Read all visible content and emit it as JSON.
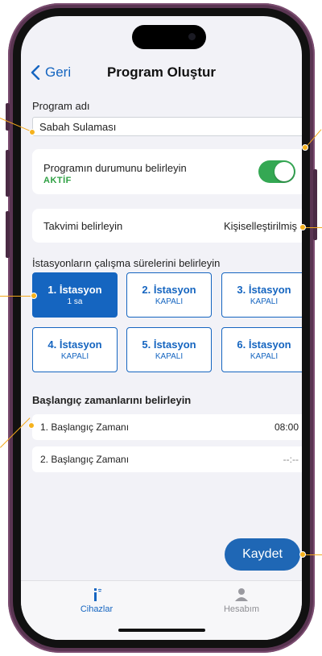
{
  "nav": {
    "back_label": "Geri",
    "title": "Program Oluştur"
  },
  "program_name": {
    "label": "Program adı",
    "value": "Sabah Sulaması"
  },
  "status": {
    "title": "Programın durumunu belirleyin",
    "value": "AKTİF",
    "enabled": true
  },
  "schedule": {
    "label": "Takvimi belirleyin",
    "value": "Kişiselleştirilmiş"
  },
  "stations": {
    "title": "İstasyonların çalışma sürelerini belirleyin",
    "items": [
      {
        "name": "1. İstasyon",
        "sub": "1 sa",
        "active": true
      },
      {
        "name": "2. İstasyon",
        "sub": "KAPALI",
        "active": false
      },
      {
        "name": "3. İstasyon",
        "sub": "KAPALI",
        "active": false
      },
      {
        "name": "4. İstasyon",
        "sub": "KAPALI",
        "active": false
      },
      {
        "name": "5. İstasyon",
        "sub": "KAPALI",
        "active": false
      },
      {
        "name": "6. İstasyon",
        "sub": "KAPALI",
        "active": false
      }
    ]
  },
  "start_times": {
    "title": "Başlangıç zamanlarını belirleyin",
    "items": [
      {
        "label": "1. Başlangıç Zamanı",
        "value": "08:00"
      },
      {
        "label": "2. Başlangıç Zamanı",
        "value": "--:--"
      }
    ]
  },
  "save_label": "Kaydet",
  "tabs": [
    {
      "label": "Cihazlar",
      "icon": "devices-icon",
      "active": true
    },
    {
      "label": "Hesabım",
      "icon": "person-icon",
      "active": false
    }
  ],
  "colors": {
    "accent": "#1565c0",
    "toggle_on": "#34a853",
    "status_text": "#2ea043",
    "callout": "#f5b21d",
    "frame": "#5a3552"
  }
}
